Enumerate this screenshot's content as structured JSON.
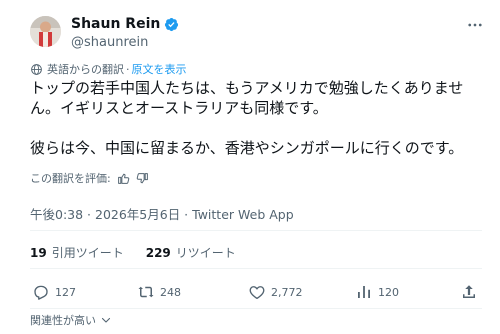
{
  "author": {
    "display_name": "Shaun Rein",
    "handle": "@shaunrein",
    "verified": true
  },
  "translation": {
    "label": "英語からの翻訳",
    "separator": "·",
    "show_original": "原文を表示"
  },
  "tweet": {
    "paragraph1": "トップの若手中国人たちは、もうアメリカで勉強したくありません。イギリスとオーストラリアも同様です。",
    "paragraph2": "彼らは今、中国に留まるか、香港やシンガポールに行くのです。"
  },
  "rate_translation": "この翻訳を評価:",
  "meta": "午後0:38 · 2026年5月6日 · Twitter Web App",
  "stats": {
    "quotes_count": "19",
    "quotes_label": "引用ツイート",
    "retweets_count": "229",
    "retweets_label": "リツイート"
  },
  "actions": {
    "replies": "127",
    "retweets": "248",
    "likes": "2,772",
    "views": "120"
  },
  "relevance": "関連性が高い",
  "colors": {
    "accent": "#1d9bf0",
    "text_primary": "#0f1419",
    "text_secondary": "#536471",
    "divider": "#eff3f4"
  }
}
